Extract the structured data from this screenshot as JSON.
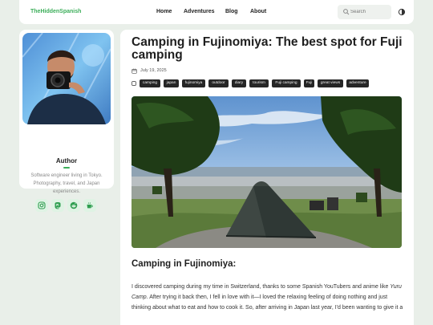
{
  "header": {
    "brand": "TheHiddenSpanish",
    "nav": [
      "Home",
      "Adventures",
      "Blog",
      "About"
    ],
    "search_placeholder": "Search",
    "theme_icon": "theme-toggle-icon"
  },
  "sidebar": {
    "author_label": "Author",
    "bio": "Software engineer living in Tokyo. Photography, travel, and Japan experiences.",
    "socials": [
      "instagram-icon",
      "mastodon-icon",
      "reddit-icon",
      "coffee-icon"
    ],
    "accent": "#3cae5a"
  },
  "article": {
    "title": "Camping in Fujinomiya: The best spot for Fuji camping",
    "date": "July 19, 2025",
    "tags": [
      "camping",
      "japan",
      "fujinomiya",
      "outdoor",
      "diary",
      "tourism",
      "Fuji camping",
      "Fuji",
      "great views",
      "adventure"
    ],
    "subheading": "Camping in Fujinomiya:",
    "intro_1": "I discovered camping during my time in Switzerland, thanks to some Spanish YouTubers and anime like ",
    "intro_em": "Yuru Camp",
    "intro_2": ". After trying it back then, I fell in love with it—I loved the relaxing feeling of doing nothing and just thinking about what to eat and how to cook it. So, after arriving in Japan last year, I'd been wanting to give it a"
  }
}
